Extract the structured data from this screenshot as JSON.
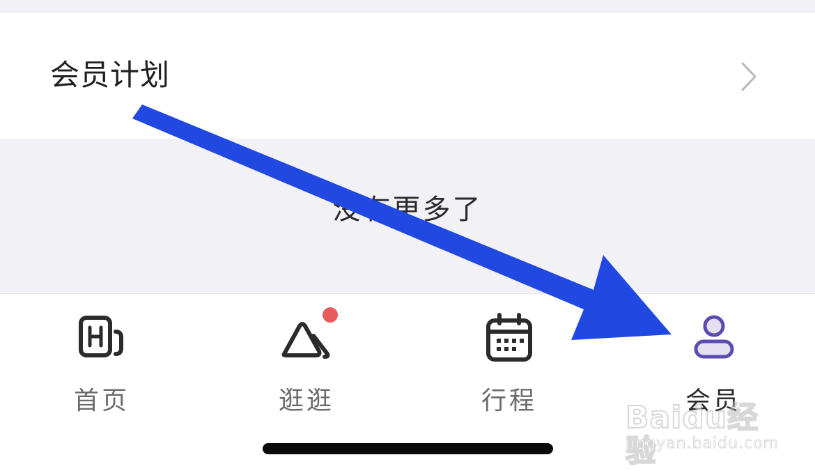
{
  "member_plan": {
    "label": "会员计划",
    "chevron_icon": "chevron-right-icon"
  },
  "list_end": {
    "text": "没有更多了"
  },
  "tabbar": {
    "tabs": [
      {
        "label": "首页",
        "icon": "home-h-icon",
        "active": false
      },
      {
        "label": "逛逛",
        "icon": "discover-icon",
        "active": false,
        "badge": true
      },
      {
        "label": "行程",
        "icon": "calendar-icon",
        "active": false
      },
      {
        "label": "会员",
        "icon": "member-icon",
        "active": true
      }
    ]
  },
  "colors": {
    "background_gray": "#f2f2f6",
    "badge_red": "#e85b5b",
    "member_accent": "#5b4bb0",
    "annotation_arrow": "#2148e0",
    "icon_dark": "#2b2b2b"
  },
  "watermark": {
    "logo": "Baidu经验",
    "url": "jingyan.baidu.com"
  }
}
